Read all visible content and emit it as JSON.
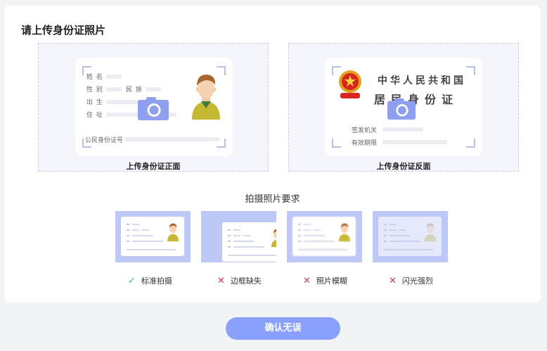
{
  "title": "请上传身份证照片",
  "front": {
    "upload_label": "上传身份证正面",
    "fields": {
      "name": "姓 名",
      "gender": "性 别",
      "ethnicity": "民 族",
      "birth": "出 生",
      "address": "住 址",
      "id_number": "公民身份证号"
    }
  },
  "back": {
    "upload_label": "上传身份证反面",
    "country": "中华人民共和国",
    "card_name": "居民身份证",
    "fields": {
      "issuer": "签发机关",
      "validity": "有效期限"
    }
  },
  "requirements": {
    "title": "拍摄照片要求",
    "items": [
      {
        "label": "标准拍摄",
        "mark": "✓",
        "color": "#3bb4a6"
      },
      {
        "label": "边框缺失",
        "mark": "✕",
        "color": "#d9363e"
      },
      {
        "label": "照片模糊",
        "mark": "✕",
        "color": "#d9363e"
      },
      {
        "label": "闪光强烈",
        "mark": "✕",
        "color": "#d9363e"
      }
    ]
  },
  "confirm_button": "确认无误",
  "colors": {
    "accent": "#8aa1fb",
    "camera": "#8f9ff0",
    "ok": "#3bb4a6",
    "error": "#d9363e"
  }
}
